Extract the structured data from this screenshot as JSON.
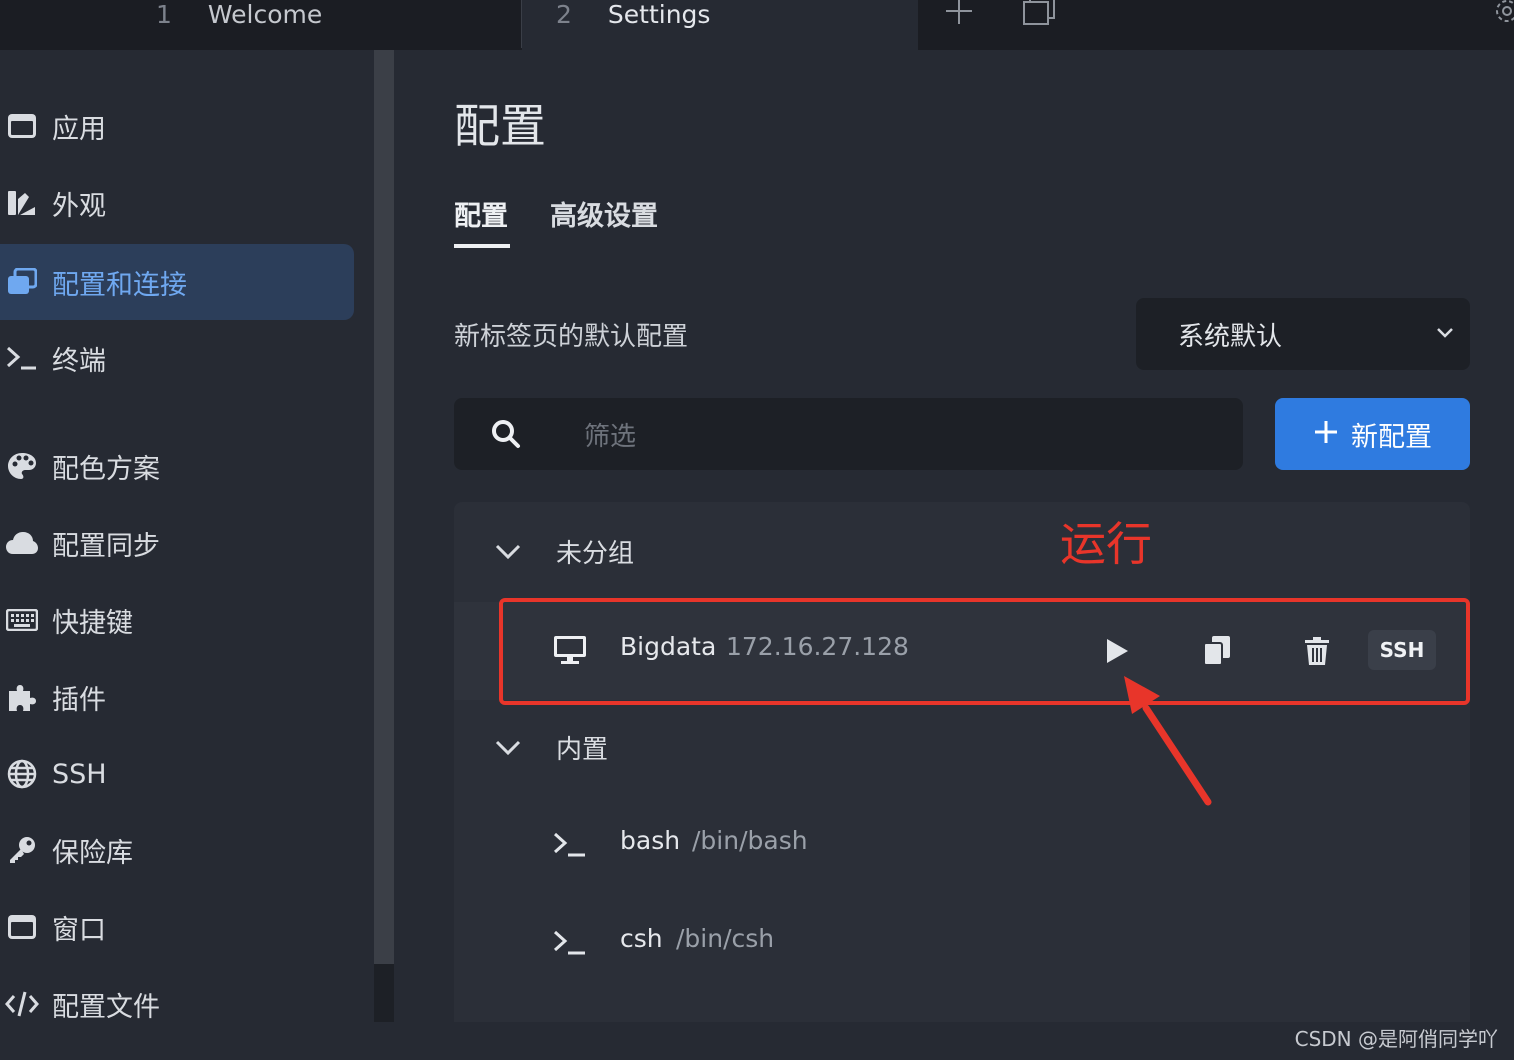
{
  "titlebar": {
    "tabs": [
      {
        "num": "1",
        "label": "Welcome"
      },
      {
        "num": "2",
        "label": "Settings"
      }
    ]
  },
  "sidebar": {
    "items": [
      {
        "label": "应用",
        "icon": "window-icon"
      },
      {
        "label": "外观",
        "icon": "palette-brush-icon"
      },
      {
        "label": "配置和连接",
        "icon": "profiles-icon",
        "active": true
      },
      {
        "label": "终端",
        "icon": "terminal-icon"
      },
      {
        "label": "配色方案",
        "icon": "color-palette-icon"
      },
      {
        "label": "配置同步",
        "icon": "cloud-icon"
      },
      {
        "label": "快捷键",
        "icon": "keyboard-icon"
      },
      {
        "label": "插件",
        "icon": "puzzle-icon"
      },
      {
        "label": "SSH",
        "icon": "globe-icon"
      },
      {
        "label": "保险库",
        "icon": "key-icon"
      },
      {
        "label": "窗口",
        "icon": "window-icon"
      },
      {
        "label": "配置文件",
        "icon": "code-icon"
      }
    ]
  },
  "main": {
    "title": "配置",
    "tabs": [
      {
        "label": "配置",
        "active": true
      },
      {
        "label": "高级设置"
      }
    ],
    "default_profile_label": "新标签页的默认配置",
    "default_profile_value": "系统默认",
    "filter_placeholder": "筛选",
    "new_profile_button": "新配置",
    "groups": [
      {
        "name": "未分组",
        "profiles": [
          {
            "name": "Bigdata",
            "detail": "172.16.27.128",
            "badge": "SSH",
            "icon": "monitor-icon"
          }
        ]
      },
      {
        "name": "内置",
        "profiles": [
          {
            "name": "bash",
            "detail": "/bin/bash",
            "icon": "terminal-icon"
          },
          {
            "name": "csh",
            "detail": "/bin/csh",
            "icon": "terminal-icon"
          }
        ]
      }
    ]
  },
  "annotation": {
    "text": "运行",
    "color": "#e8352a"
  },
  "watermark": "CSDN @是阿俏同学吖",
  "colors": {
    "accent": "#2f7be0",
    "active_nav": "#6fa8f0",
    "annotation": "#e8352a"
  }
}
